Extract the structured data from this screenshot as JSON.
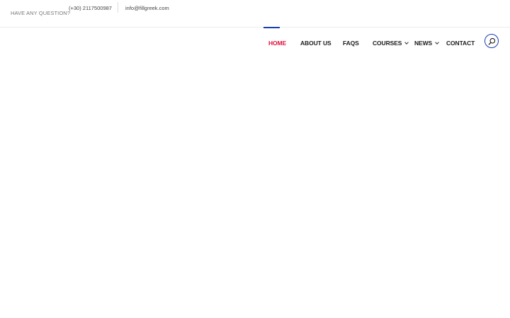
{
  "topbar": {
    "question": "HAVE ANY QUESTION?",
    "phone": "(+30) 2117500987",
    "email": "info@fillgreek.com"
  },
  "nav": {
    "items": [
      {
        "label": "HOME",
        "active": true
      },
      {
        "label": "ABOUT US"
      },
      {
        "label": "FAQS"
      },
      {
        "label": "COURSES",
        "dropdown": true
      },
      {
        "label": "NEWS",
        "dropdown": true
      },
      {
        "label": "CONTACT"
      }
    ],
    "search_icon": "search-icon"
  },
  "colors": {
    "active": "#e0103c",
    "accent": "#1a3bb3"
  }
}
